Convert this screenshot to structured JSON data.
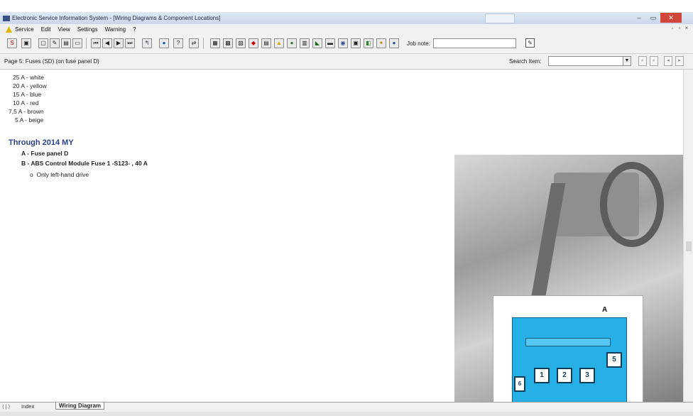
{
  "window": {
    "title": "Electronic Service Information System - [Wiring Diagrams & Component Locations]"
  },
  "menu": [
    "Service",
    "Edit",
    "View",
    "Settings",
    "Warning",
    "?"
  ],
  "toolbar": {
    "job_note_label": "Job note:",
    "job_note_value": ""
  },
  "path": {
    "page_label": "Page 5: Fuses (SD) (on fuse panel D)",
    "search_label": "Search Item:",
    "search_value": ""
  },
  "fuse_colors": [
    "25 A - white",
    "20 A - yellow",
    "15 A - blue",
    "10 A - red",
    "7,5 A - brown",
    "5 A - beige"
  ],
  "section": {
    "heading": "Through 2014 MY",
    "items": [
      "A - Fuse panel D",
      "B - ABS Control Module Fuse 1 -S123- , 40 A"
    ],
    "bullet": "Only left-hand drive"
  },
  "figure": {
    "callout": "A",
    "fuse_numbers": [
      "1",
      "2",
      "3",
      "5",
      "6"
    ]
  },
  "tabs": {
    "index": "Index",
    "active": "Wiring Diagram"
  },
  "colors": {
    "heading": "#2b3f8a",
    "fusebox": "#27b0e6"
  }
}
